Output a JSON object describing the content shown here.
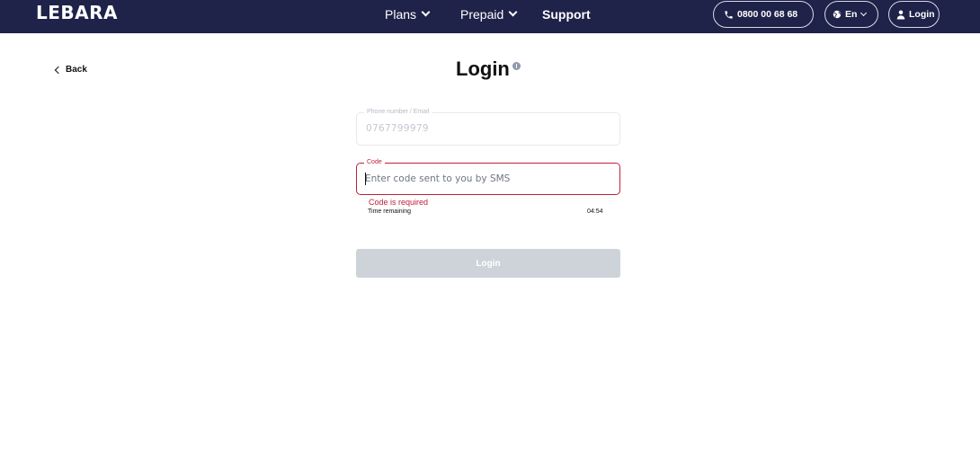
{
  "brand": {
    "logo": "LEBARA",
    "accent": "#1f2249",
    "error_color": "#c0203a"
  },
  "nav": {
    "items": [
      {
        "label": "Plans",
        "icon": "chevron-down-icon"
      },
      {
        "label": "Prepaid",
        "icon": "chevron-down-icon"
      },
      {
        "label": "Support"
      }
    ]
  },
  "header_actions": {
    "phone": "0800 00 68 68",
    "language": "En",
    "login": "Login"
  },
  "page": {
    "back": "Back",
    "title": "Login"
  },
  "form": {
    "phone_label": "Phone number / Email",
    "phone_value": "0767799979",
    "code_label": "Code",
    "code_value": "",
    "code_placeholder": "Enter code sent to you by SMS",
    "error": "Code is required",
    "time_label": "Time remaining",
    "time_value": "04:54",
    "submit": "Login"
  }
}
